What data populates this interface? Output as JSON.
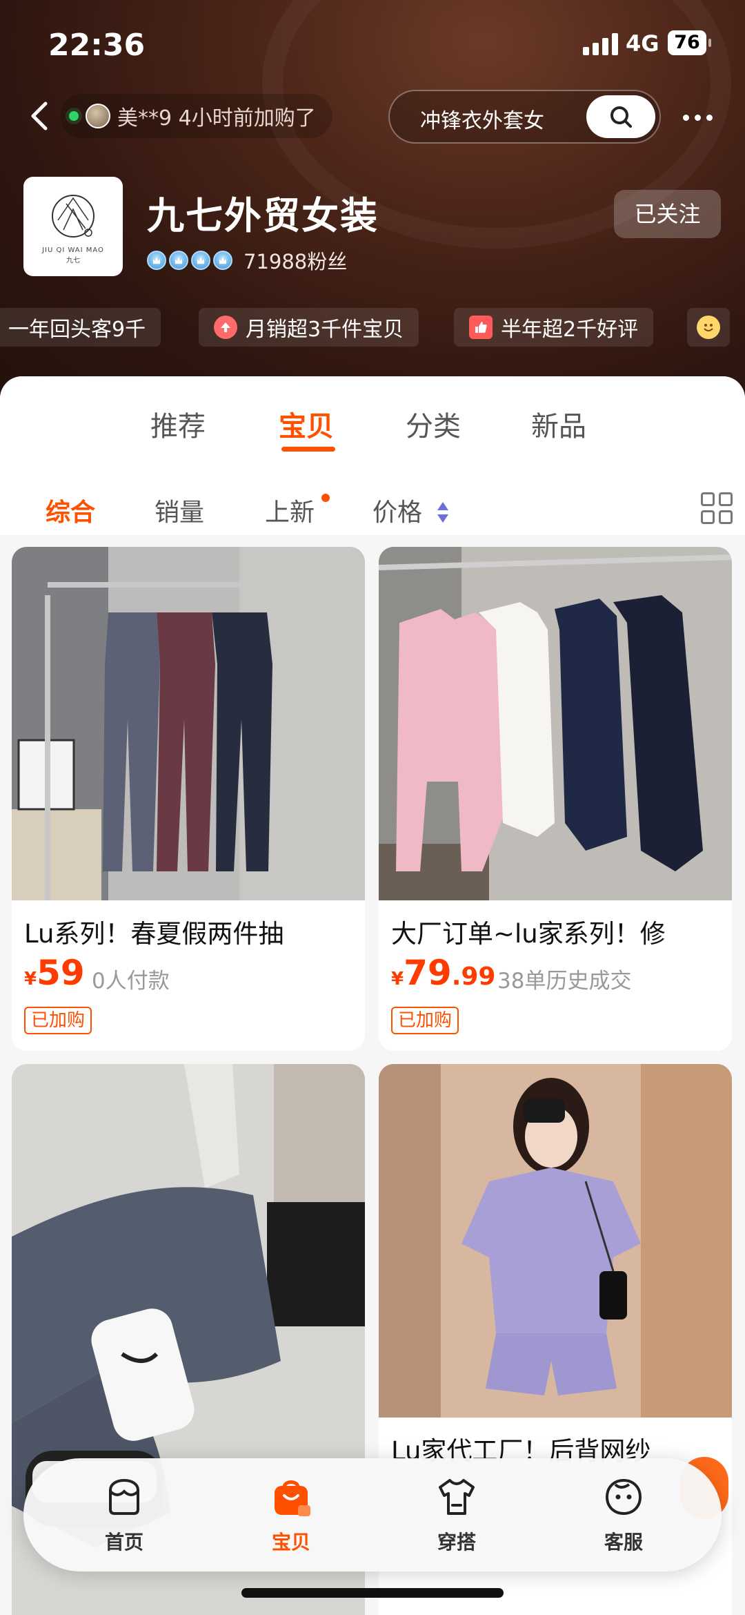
{
  "status_bar": {
    "time": "22:36",
    "network": "4G",
    "battery": "76"
  },
  "top": {
    "activity_text": "美**9 4小时前加购了",
    "search_text": "冲锋衣外套女"
  },
  "store": {
    "logo_en": "JIU QI WAI MAO",
    "logo_cn": "九七",
    "name": "九七外贸女装",
    "fans": "71988粉丝",
    "follow_label": "已关注",
    "badges": [
      {
        "text": "一年回头客9千",
        "icon": ""
      },
      {
        "text": "月销超3千件宝贝",
        "icon": "up-arrow-icon"
      },
      {
        "text": "半年超2千好评",
        "icon": "thumbs-up-icon"
      }
    ]
  },
  "tabs": [
    "推荐",
    "宝贝",
    "分类",
    "新品"
  ],
  "sort_options": [
    "综合",
    "销量",
    "上新",
    "价格"
  ],
  "products": [
    {
      "title": "Lu系列！春夏假两件抽",
      "price_int": "59",
      "price_dec": "",
      "sales": "0人付款",
      "tag": "已加购"
    },
    {
      "title": "大厂订单~lu家系列！修",
      "price_int": "79",
      "price_dec": ".99",
      "sales": "38单历史成交",
      "tag": "已加购"
    },
    {
      "title": "",
      "price_int": "",
      "price_dec": "",
      "sales": "",
      "tag": ""
    },
    {
      "title": "Lu家代工厂！后背网纱",
      "price_int": "",
      "price_dec": "",
      "sales": "",
      "tag": ""
    }
  ],
  "currency": "¥",
  "bottom_nav": [
    "首页",
    "宝贝",
    "穿搭",
    "客服"
  ],
  "colors": {
    "accent": "#ff5000",
    "price": "#ff3b00",
    "header_bg": "#3a1c12"
  }
}
